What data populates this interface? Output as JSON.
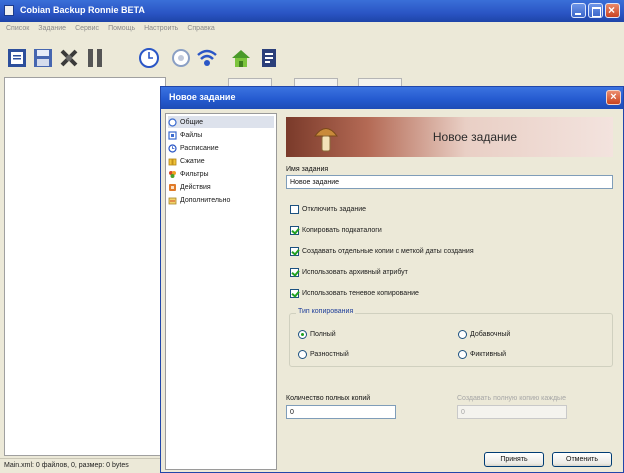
{
  "main_window": {
    "title": "Cobian Backup Ronnie BETA",
    "menu": [
      "Список",
      "Задание",
      "Сервис",
      "Помощь",
      "Настроить",
      "Справка"
    ],
    "status": "Main.xml: 0 файлов, 0, размер: 0 bytes"
  },
  "toolbar": {
    "items": [
      {
        "icon": "new-list-icon"
      },
      {
        "icon": "save-icon"
      },
      {
        "icon": "tools-icon"
      },
      {
        "icon": "pause-icon"
      },
      {
        "icon": "clock-icon"
      },
      {
        "icon": "settings-icon"
      },
      {
        "icon": "wireless-icon"
      },
      {
        "icon": "home-icon"
      },
      {
        "icon": "help-icon"
      }
    ]
  },
  "dialog": {
    "title": "Новое задание",
    "nav": [
      {
        "label": "Общие",
        "icon": "general-icon",
        "selected": true
      },
      {
        "label": "Файлы",
        "icon": "files-icon"
      },
      {
        "label": "Расписание",
        "icon": "schedule-icon"
      },
      {
        "label": "Сжатие",
        "icon": "compression-icon"
      },
      {
        "label": "Фильтры",
        "icon": "filters-icon"
      },
      {
        "label": "Действия",
        "icon": "actions-icon"
      },
      {
        "label": "Дополнительно",
        "icon": "advanced-icon"
      }
    ],
    "banner_title": "Новое задание",
    "task_name_label": "Имя задания",
    "task_name_value": "Новое задание",
    "checkboxes": [
      {
        "label": "Отключить задание",
        "checked": false
      },
      {
        "label": "Копировать подкаталоги",
        "checked": true
      },
      {
        "label": "Создавать отдельные копии с меткой даты создания",
        "checked": true
      },
      {
        "label": "Использовать архивный атрибут",
        "checked": true
      },
      {
        "label": "Использовать теневое копирование",
        "checked": true
      }
    ],
    "copy_type": {
      "legend": "Тип копирования",
      "options": [
        {
          "label": "Полный",
          "checked": true
        },
        {
          "label": "Добавочный",
          "checked": false
        },
        {
          "label": "Разностный",
          "checked": false
        },
        {
          "label": "Фиктивный",
          "checked": false
        }
      ]
    },
    "full_copies_label": "Количество полных копий",
    "full_copies_value": "0",
    "diff_label": "Создавать полную копию каждые",
    "diff_value": "0",
    "ok_label": "Принять",
    "cancel_label": "Отменить"
  }
}
